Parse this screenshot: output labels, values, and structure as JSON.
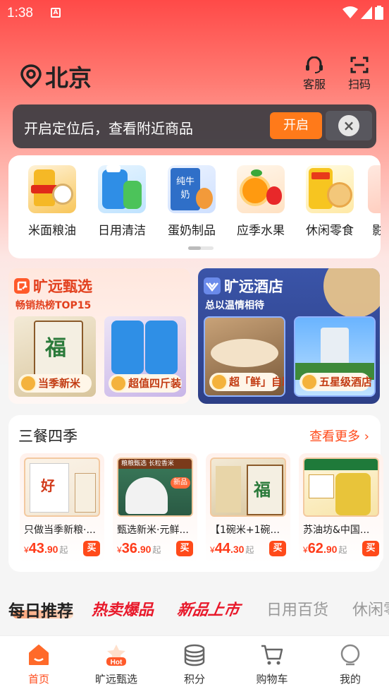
{
  "status_bar": {
    "time": "1:38",
    "notif_glyph": "A"
  },
  "header": {
    "city": "北京",
    "service_label": "客服",
    "scan_label": "扫码"
  },
  "toast": {
    "message": "开启定位后，查看附近商品",
    "open_label": "开启",
    "close_icon": "×"
  },
  "categories": [
    {
      "label": "米面粮油",
      "icon": "rice-oil-icon",
      "color": "#f5a623"
    },
    {
      "label": "日用清洁",
      "icon": "detergent-icon",
      "color": "#3b8fe0"
    },
    {
      "label": "蛋奶制品",
      "icon": "milk-icon",
      "color": "#2f6fc8"
    },
    {
      "label": "应季水果",
      "icon": "orange-icon",
      "color": "#ff8a00"
    },
    {
      "label": "休闲零食",
      "icon": "snack-icon",
      "color": "#f0c020"
    },
    {
      "label": "影",
      "icon": "partial-icon",
      "color": "#e06040"
    }
  ],
  "promo_left": {
    "title": "旷远甄选",
    "subtitle": "畅销热榜TOP15",
    "tiles": [
      {
        "tag": "当季新米"
      },
      {
        "tag": "超值四斤装"
      }
    ]
  },
  "promo_right": {
    "title": "旷远酒店",
    "subtitle": "总以温情相待",
    "tiles": [
      {
        "tag": "超「鲜」自助"
      },
      {
        "tag": "五星级酒店"
      }
    ]
  },
  "meals": {
    "title": "三餐四季",
    "more_label": "查看更多",
    "products": [
      {
        "name": "只做当季新粮·...",
        "cur": "¥",
        "int": "43",
        "dec": ".90",
        "qi": "起",
        "buy": "买"
      },
      {
        "name": "甄选新米·元鲜...",
        "cur": "¥",
        "int": "36",
        "dec": ".90",
        "qi": "起",
        "buy": "买"
      },
      {
        "name": "【1碗米+1碗...",
        "cur": "¥",
        "int": "44",
        "dec": ".30",
        "qi": "起",
        "buy": "买"
      },
      {
        "name": "苏油坊&中国...",
        "cur": "¥",
        "int": "62",
        "dec": ".90",
        "qi": "起",
        "buy": "买"
      }
    ]
  },
  "daily": {
    "title": "每日推荐",
    "tabs": [
      "热卖爆品",
      "新品上市",
      "日用百货",
      "休闲零"
    ]
  },
  "bottom_nav": [
    {
      "label": "首页",
      "active": true
    },
    {
      "label": "旷远甄选",
      "active": false
    },
    {
      "label": "积分",
      "active": false
    },
    {
      "label": "购物车",
      "active": false
    },
    {
      "label": "我的",
      "active": false
    }
  ],
  "colors": {
    "brand_red": "#ff4a48",
    "accent_orange": "#ff7a1a",
    "price_red": "#ff3b1a",
    "hotel_blue": "#2d3f86"
  }
}
